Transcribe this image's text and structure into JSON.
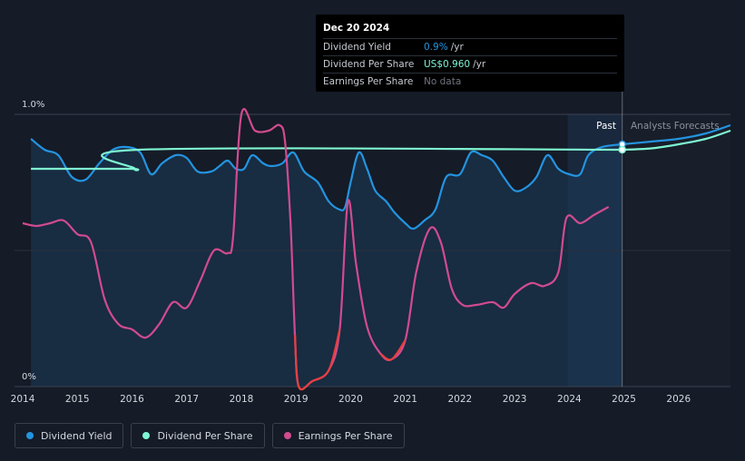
{
  "tooltip": {
    "date": "Dec 20 2024",
    "rows": [
      {
        "label": "Dividend Yield",
        "value": "0.9%",
        "unit": "/yr"
      },
      {
        "label": "Dividend Per Share",
        "value": "US$0.960",
        "unit": "/yr"
      },
      {
        "label": "Earnings Per Share",
        "value": "No data",
        "unit": ""
      }
    ]
  },
  "labels": {
    "past": "Past",
    "forecast": "Analysts Forecasts"
  },
  "legend": [
    {
      "label": "Dividend Yield",
      "color": "#2394df"
    },
    {
      "label": "Dividend Per Share",
      "color": "#7ff5d2"
    },
    {
      "label": "Earnings Per Share",
      "color": "#d14b8f"
    }
  ],
  "chart_data": {
    "type": "line",
    "ytick_labels": [
      "1.0%",
      "0%"
    ],
    "ylim": [
      0,
      1.0
    ],
    "xlim": [
      2013.85,
      2026.95
    ],
    "x_ticks": [
      "2014",
      "2015",
      "2016",
      "2017",
      "2018",
      "2019",
      "2020",
      "2021",
      "2022",
      "2023",
      "2024",
      "2025",
      "2026"
    ],
    "past_end": 2024.97,
    "shaded_start": 2023.97,
    "series": [
      {
        "name": "Dividend Yield",
        "color": "#2394df",
        "points": [
          [
            2014.15,
            0.91
          ],
          [
            2014.4,
            0.87
          ],
          [
            2014.65,
            0.85
          ],
          [
            2014.9,
            0.77
          ],
          [
            2015.15,
            0.76
          ],
          [
            2015.4,
            0.82
          ],
          [
            2015.65,
            0.87
          ],
          [
            2015.9,
            0.88
          ],
          [
            2016.15,
            0.86
          ],
          [
            2016.35,
            0.78
          ],
          [
            2016.55,
            0.82
          ],
          [
            2016.8,
            0.85
          ],
          [
            2017.0,
            0.84
          ],
          [
            2017.2,
            0.79
          ],
          [
            2017.45,
            0.79
          ],
          [
            2017.6,
            0.81
          ],
          [
            2017.75,
            0.83
          ],
          [
            2017.9,
            0.8
          ],
          [
            2018.05,
            0.8
          ],
          [
            2018.2,
            0.85
          ],
          [
            2018.4,
            0.82
          ],
          [
            2018.55,
            0.81
          ],
          [
            2018.75,
            0.82
          ],
          [
            2018.95,
            0.86
          ],
          [
            2019.15,
            0.79
          ],
          [
            2019.4,
            0.75
          ],
          [
            2019.6,
            0.68
          ],
          [
            2019.8,
            0.65
          ],
          [
            2019.9,
            0.66
          ],
          [
            2020.0,
            0.75
          ],
          [
            2020.15,
            0.86
          ],
          [
            2020.3,
            0.8
          ],
          [
            2020.45,
            0.72
          ],
          [
            2020.65,
            0.68
          ],
          [
            2020.8,
            0.64
          ],
          [
            2021.0,
            0.6
          ],
          [
            2021.15,
            0.58
          ],
          [
            2021.35,
            0.61
          ],
          [
            2021.55,
            0.65
          ],
          [
            2021.75,
            0.77
          ],
          [
            2022.0,
            0.78
          ],
          [
            2022.2,
            0.86
          ],
          [
            2022.4,
            0.85
          ],
          [
            2022.6,
            0.83
          ],
          [
            2022.8,
            0.77
          ],
          [
            2023.0,
            0.72
          ],
          [
            2023.2,
            0.73
          ],
          [
            2023.4,
            0.77
          ],
          [
            2023.6,
            0.85
          ],
          [
            2023.8,
            0.8
          ],
          [
            2024.0,
            0.78
          ],
          [
            2024.2,
            0.78
          ],
          [
            2024.35,
            0.85
          ],
          [
            2024.6,
            0.88
          ],
          [
            2024.97,
            0.89
          ]
        ]
      },
      {
        "name": "Dividend Yield Forecast",
        "color": "#2394df",
        "points": [
          [
            2024.97,
            0.89
          ],
          [
            2025.5,
            0.9
          ],
          [
            2026.0,
            0.91
          ],
          [
            2026.5,
            0.93
          ],
          [
            2026.95,
            0.96
          ]
        ]
      },
      {
        "name": "Dividend Per Share",
        "color": "#7ff5d2",
        "points": [
          [
            2014.15,
            0.8
          ],
          [
            2015.95,
            0.8
          ],
          [
            2016.05,
            0.8
          ],
          [
            2016.12,
            0.87
          ],
          [
            2024.97,
            0.87
          ]
        ]
      },
      {
        "name": "Dividend Per Share Forecast",
        "color": "#7ff5d2",
        "points": [
          [
            2024.97,
            0.87
          ],
          [
            2025.5,
            0.875
          ],
          [
            2026.0,
            0.89
          ],
          [
            2026.5,
            0.91
          ],
          [
            2026.95,
            0.94
          ]
        ]
      },
      {
        "name": "Earnings Per Share",
        "color": "#d14b8f",
        "points": [
          [
            2014.0,
            0.6
          ],
          [
            2014.25,
            0.59
          ],
          [
            2014.5,
            0.6
          ],
          [
            2014.75,
            0.61
          ],
          [
            2015.0,
            0.56
          ],
          [
            2015.25,
            0.53
          ],
          [
            2015.5,
            0.32
          ],
          [
            2015.75,
            0.23
          ],
          [
            2016.0,
            0.21
          ],
          [
            2016.25,
            0.18
          ],
          [
            2016.5,
            0.23
          ],
          [
            2016.75,
            0.31
          ],
          [
            2017.0,
            0.29
          ],
          [
            2017.25,
            0.39
          ],
          [
            2017.5,
            0.5
          ],
          [
            2017.75,
            0.49
          ],
          [
            2017.85,
            0.55
          ],
          [
            2018.0,
            1.0
          ],
          [
            2018.25,
            0.94
          ],
          [
            2018.5,
            0.94
          ],
          [
            2018.7,
            0.96
          ],
          [
            2018.8,
            0.9
          ],
          [
            2018.9,
            0.6
          ],
          [
            2018.98,
            0.19
          ],
          [
            2019.05,
            0.0
          ],
          [
            2019.3,
            0.02
          ],
          [
            2019.6,
            0.06
          ],
          [
            2019.8,
            0.21
          ],
          [
            2019.95,
            0.68
          ],
          [
            2020.1,
            0.45
          ],
          [
            2020.3,
            0.22
          ],
          [
            2020.55,
            0.12
          ],
          [
            2020.75,
            0.1
          ],
          [
            2021.0,
            0.17
          ],
          [
            2021.2,
            0.42
          ],
          [
            2021.45,
            0.58
          ],
          [
            2021.65,
            0.53
          ],
          [
            2021.85,
            0.36
          ],
          [
            2022.05,
            0.3
          ],
          [
            2022.3,
            0.3
          ],
          [
            2022.6,
            0.31
          ],
          [
            2022.8,
            0.29
          ],
          [
            2023.0,
            0.34
          ],
          [
            2023.3,
            0.38
          ],
          [
            2023.55,
            0.37
          ],
          [
            2023.8,
            0.42
          ],
          [
            2023.95,
            0.62
          ],
          [
            2024.2,
            0.6
          ],
          [
            2024.45,
            0.63
          ],
          [
            2024.72,
            0.66
          ]
        ]
      }
    ]
  }
}
